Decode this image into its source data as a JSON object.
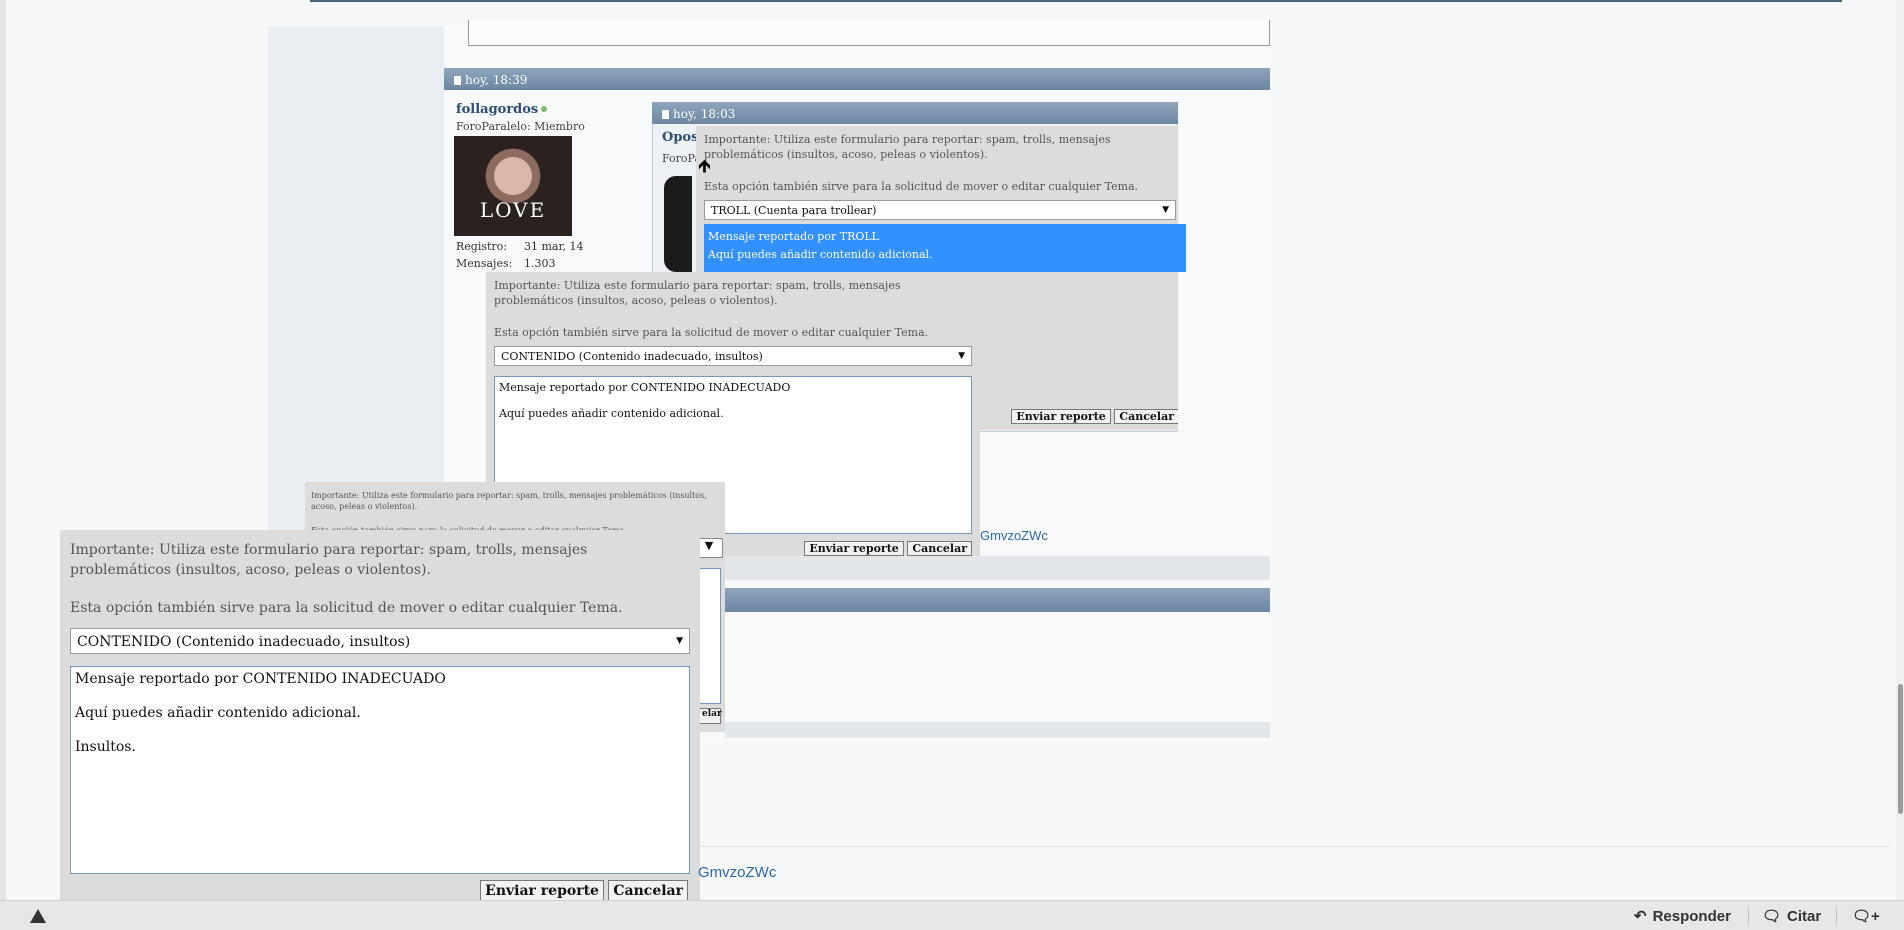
{
  "post": {
    "timestamp": "hoy, 18:39",
    "username": "follagordos",
    "role": "ForoParalelo: Miembro",
    "avatar_text": "LOVE",
    "registro_label": "Registro:",
    "registro_value": "31 mar, 14",
    "mensajes_label": "Mensajes:",
    "mensajes_value": "1.303"
  },
  "quote": {
    "timestamp": "hoy, 18:03",
    "username": "Opos",
    "role": "ForoPa"
  },
  "report_top": {
    "notice": "Importante: Utiliza este formulario para reportar: spam, trolls, mensajes problemáticos (insultos, acoso, peleas o violentos).",
    "hint": "Esta opción también sirve para la solicitud de mover o editar cualquier Tema.",
    "selected": "TROLL (Cuenta para trollear)",
    "list_line1": "Mensaje reportado por TROLL",
    "list_line2": "Aquí puedes añadir contenido adicional.",
    "send_label": "Enviar reporte",
    "cancel_label": "Cancelar"
  },
  "report_mid": {
    "notice": "Importante: Utiliza este formulario para reportar: spam, trolls, mensajes problemáticos (insultos, acoso, peleas o violentos).",
    "hint": "Esta opción también sirve para la solicitud de mover o editar cualquier Tema.",
    "selected": "CONTENIDO (Contenido inadecuado, insultos)",
    "text": "Mensaje reportado por CONTENIDO INADECUADO\n\nAquí puedes añadir contenido adicional.",
    "send_label": "Enviar reporte",
    "cancel_label": "Cancelar"
  },
  "report_small": {
    "notice": "Importante: Utiliza este formulario para reportar: spam, trolls, mensajes problemáticos (insultos, acoso, peleas o violentos).",
    "hint": "Esta opción también sirve para la solicitud de mover o editar cualquier Tema.",
    "cut_button": "elar"
  },
  "report_main": {
    "notice": "Importante: Utiliza este formulario para reportar: spam, trolls, mensajes problemáticos (insultos, acoso, peleas o violentos).",
    "hint": "Esta opción también sirve para la solicitud de mover o editar cualquier Tema.",
    "selected": "CONTENIDO (Contenido inadecuado, insultos)",
    "text": "Mensaje reportado por CONTENIDO INADECUADO\n\nAquí puedes añadir contenido adicional.\n\nInsultos.",
    "send_label": "Enviar reporte",
    "cancel_label": "Cancelar"
  },
  "links": {
    "mid": "GmvzoZWc",
    "bottom": "GmvzoZWc"
  },
  "bottom_bar": {
    "responder": "Responder",
    "citar": "Citar"
  }
}
